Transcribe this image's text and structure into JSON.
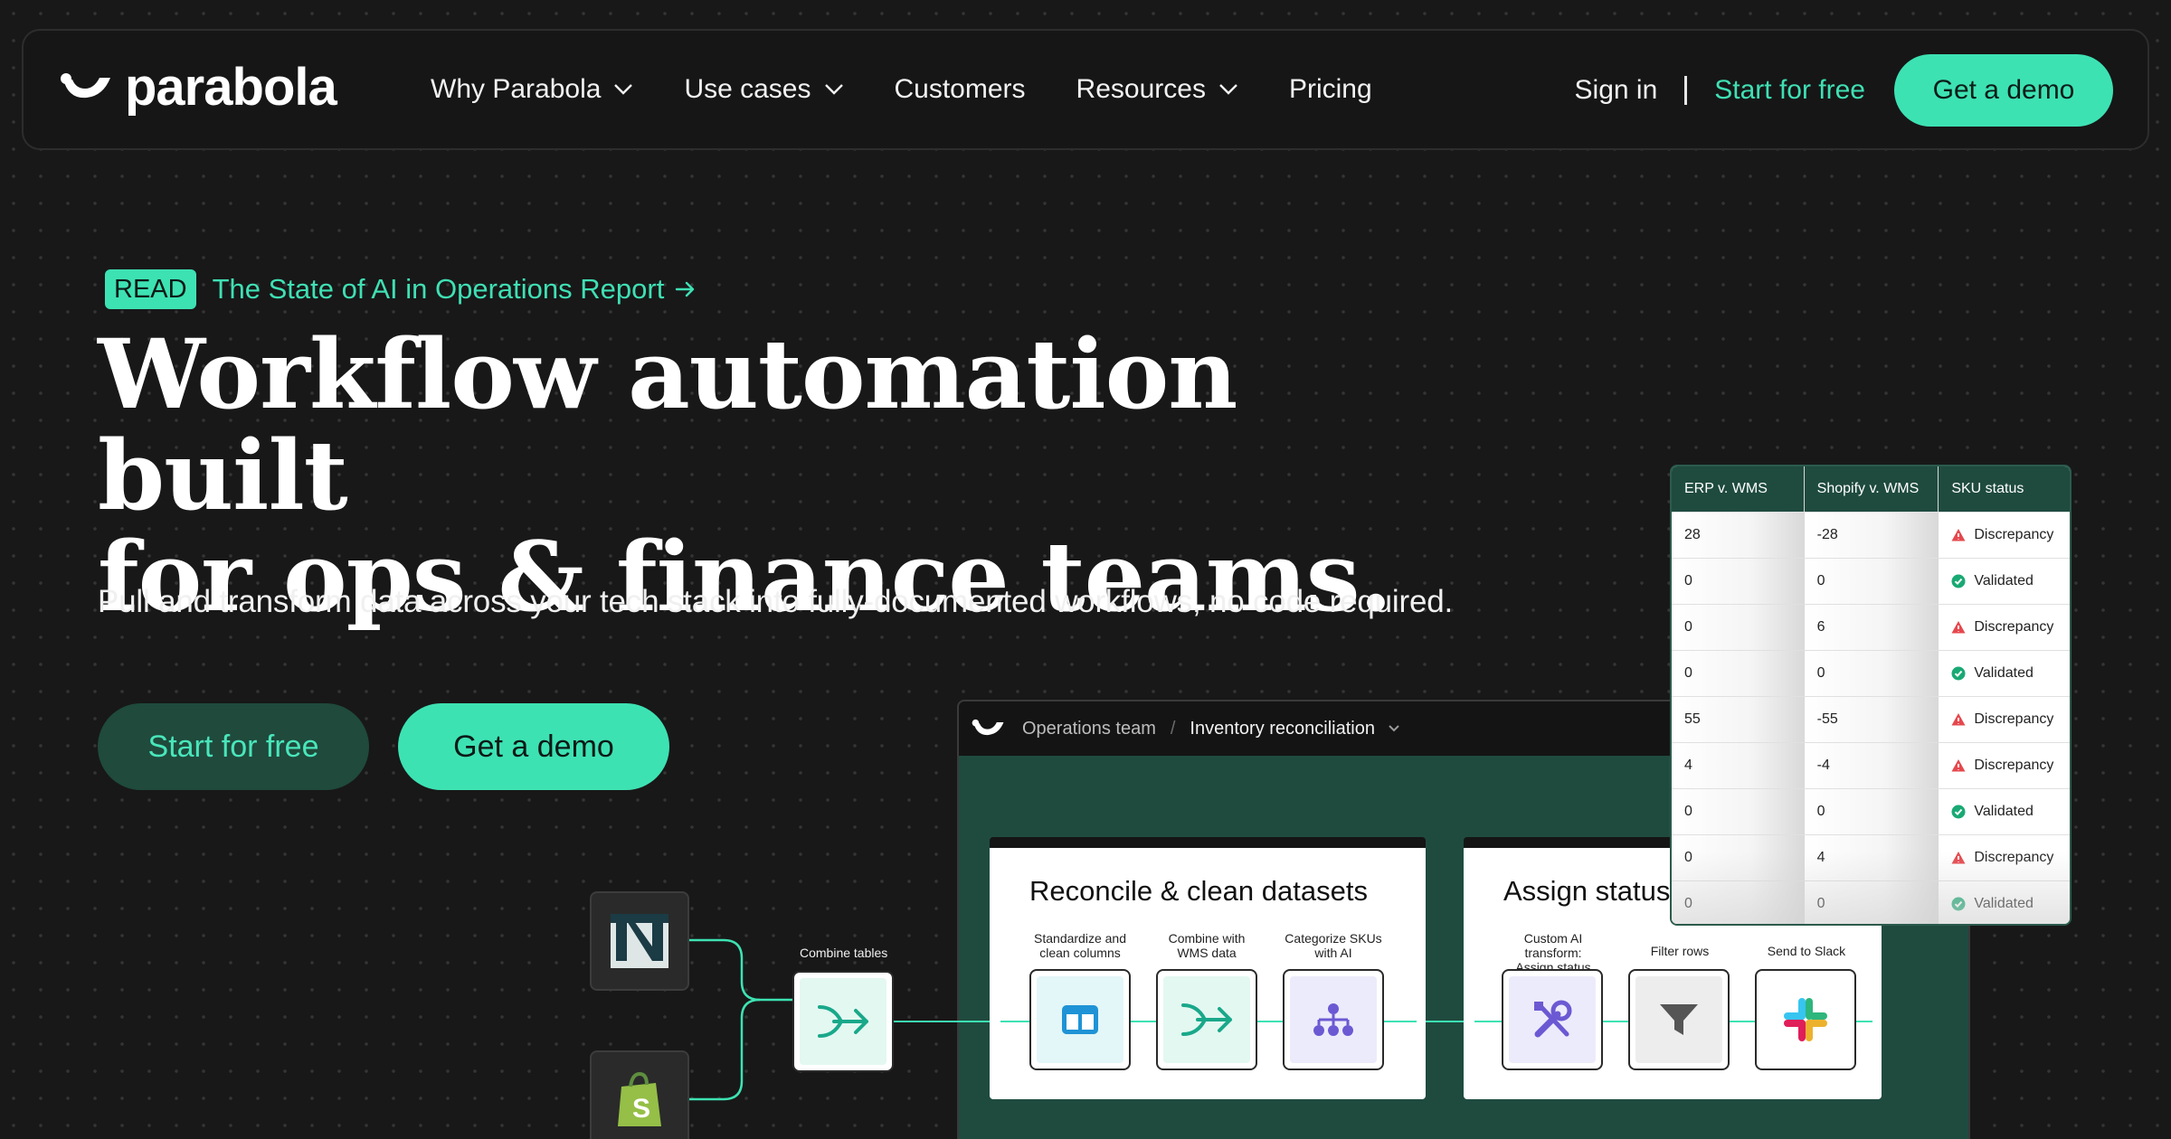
{
  "nav": {
    "logo_text": "parabola",
    "links": [
      {
        "label": "Why Parabola",
        "dropdown": true
      },
      {
        "label": "Use cases",
        "dropdown": true
      },
      {
        "label": "Customers",
        "dropdown": false
      },
      {
        "label": "Resources",
        "dropdown": true
      },
      {
        "label": "Pricing",
        "dropdown": false
      }
    ],
    "sign_in": "Sign in",
    "start_free": "Start for free",
    "get_demo": "Get a demo"
  },
  "hero": {
    "badge": "READ",
    "badge_link": "The State of AI in Operations Report",
    "title_line1": "Workflow automation built",
    "title_line2": "for ops & finance teams.",
    "subtitle": "Pull and transform data across your tech stack into fully-documented workflows, no code required.",
    "start_free": "Start for free",
    "get_demo": "Get a demo"
  },
  "app": {
    "team": "Operations team",
    "separator": "/",
    "workflow": "Inventory reconciliation",
    "combine_label": "Combine tables",
    "card1": {
      "title": "Reconcile & clean datasets",
      "steps": [
        {
          "line1": "Standardize and",
          "line2": "clean columns"
        },
        {
          "line1": "Combine with",
          "line2": "WMS data"
        },
        {
          "line1": "Categorize SKUs",
          "line2": "with AI"
        }
      ]
    },
    "card2": {
      "title": "Assign status",
      "steps": [
        {
          "line1": "Custom AI transform:",
          "line2": "Assign status"
        },
        {
          "line1": "Filter rows",
          "line2": ""
        },
        {
          "line1": "Send to Slack",
          "line2": ""
        }
      ]
    }
  },
  "table": {
    "headers": [
      "ERP v. WMS",
      "Shopify v. WMS",
      "SKU status"
    ],
    "rows": [
      [
        "28",
        "-28",
        "Discrepancy"
      ],
      [
        "0",
        "0",
        "Validated"
      ],
      [
        "0",
        "6",
        "Discrepancy"
      ],
      [
        "0",
        "0",
        "Validated"
      ],
      [
        "55",
        "-55",
        "Discrepancy"
      ],
      [
        "4",
        "-4",
        "Discrepancy"
      ],
      [
        "0",
        "0",
        "Validated"
      ],
      [
        "0",
        "4",
        "Discrepancy"
      ],
      [
        "0",
        "0",
        "Validated"
      ]
    ]
  },
  "colors": {
    "accent": "#3de2b3",
    "background": "#181818",
    "canvas": "#1f4b3f",
    "discrepancy": "#e5484d",
    "validated": "#19a974"
  }
}
